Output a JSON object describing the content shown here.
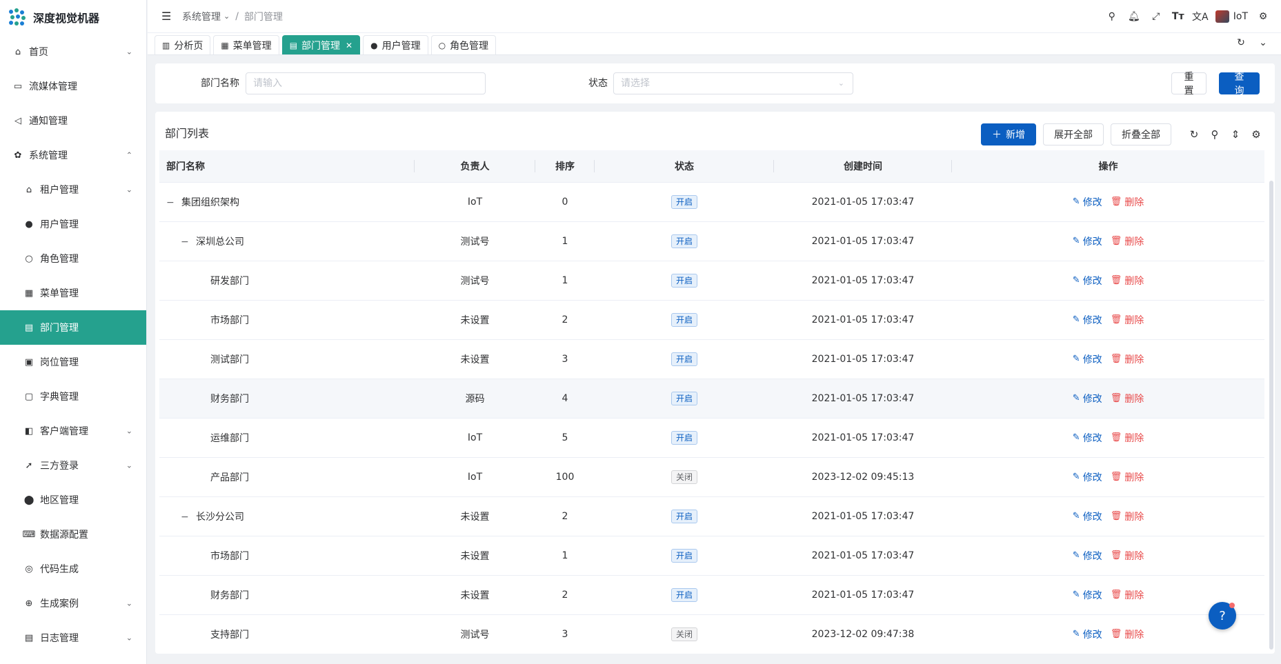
{
  "app": {
    "title": "深度视觉机器"
  },
  "sidebar": {
    "items": [
      {
        "label": "首页",
        "icon": "home-icon",
        "chevron": "⌄"
      },
      {
        "label": "流媒体管理",
        "icon": "video-icon",
        "chevron": ""
      },
      {
        "label": "通知管理",
        "icon": "megaphone-icon",
        "chevron": ""
      },
      {
        "label": "系统管理",
        "icon": "gear-icon",
        "chevron": "⌃"
      },
      {
        "label": "租户管理",
        "icon": "tenant-icon",
        "chevron": "⌄"
      },
      {
        "label": "用户管理",
        "icon": "user-icon",
        "chevron": ""
      },
      {
        "label": "角色管理",
        "icon": "role-icon",
        "chevron": ""
      },
      {
        "label": "菜单管理",
        "icon": "menu-grid-icon",
        "chevron": ""
      },
      {
        "label": "部门管理",
        "icon": "id-card-icon",
        "chevron": ""
      },
      {
        "label": "岗位管理",
        "icon": "post-icon",
        "chevron": ""
      },
      {
        "label": "字典管理",
        "icon": "dictionary-icon",
        "chevron": ""
      },
      {
        "label": "客户端管理",
        "icon": "client-icon",
        "chevron": "⌄"
      },
      {
        "label": "三方登录",
        "icon": "rocket-icon",
        "chevron": "⌄"
      },
      {
        "label": "地区管理",
        "icon": "location-icon",
        "chevron": ""
      },
      {
        "label": "数据源配置",
        "icon": "datasource-icon",
        "chevron": ""
      },
      {
        "label": "代码生成",
        "icon": "code-icon",
        "chevron": ""
      },
      {
        "label": "生成案例",
        "icon": "example-icon",
        "chevron": "⌄"
      },
      {
        "label": "日志管理",
        "icon": "log-icon",
        "chevron": "⌄"
      }
    ]
  },
  "header": {
    "breadcrumb": [
      "系统管理",
      "部门管理"
    ],
    "user": "IoT"
  },
  "tabs": [
    {
      "label": "分析页",
      "icon": "chart-icon"
    },
    {
      "label": "菜单管理",
      "icon": "menu-grid-icon"
    },
    {
      "label": "部门管理",
      "icon": "id-card-icon"
    },
    {
      "label": "用户管理",
      "icon": "user-icon"
    },
    {
      "label": "角色管理",
      "icon": "role-icon"
    }
  ],
  "search": {
    "dept_label": "部门名称",
    "dept_placeholder": "请输入",
    "status_label": "状态",
    "status_placeholder": "请选择",
    "reset": "重置",
    "query": "查询"
  },
  "table": {
    "title": "部门列表",
    "add": "新增",
    "expand_all": "展开全部",
    "collapse_all": "折叠全部",
    "columns": [
      "部门名称",
      "负责人",
      "排序",
      "状态",
      "创建时间",
      "操作"
    ],
    "edit_label": "修改",
    "delete_label": "删除",
    "rows": [
      {
        "name": "集团组织架构",
        "level": 0,
        "toggle": "−",
        "leader": "IoT",
        "sort": "0",
        "status": "开启",
        "on": true,
        "created": "2021-01-05 17:03:47"
      },
      {
        "name": "深圳总公司",
        "level": 1,
        "toggle": "−",
        "leader": "测试号",
        "sort": "1",
        "status": "开启",
        "on": true,
        "created": "2021-01-05 17:03:47"
      },
      {
        "name": "研发部门",
        "level": 2,
        "toggle": "",
        "leader": "测试号",
        "sort": "1",
        "status": "开启",
        "on": true,
        "created": "2021-01-05 17:03:47"
      },
      {
        "name": "市场部门",
        "level": 2,
        "toggle": "",
        "leader": "未设置",
        "sort": "2",
        "status": "开启",
        "on": true,
        "created": "2021-01-05 17:03:47"
      },
      {
        "name": "测试部门",
        "level": 2,
        "toggle": "",
        "leader": "未设置",
        "sort": "3",
        "status": "开启",
        "on": true,
        "created": "2021-01-05 17:03:47"
      },
      {
        "name": "财务部门",
        "level": 2,
        "toggle": "",
        "leader": "源码",
        "sort": "4",
        "status": "开启",
        "on": true,
        "created": "2021-01-05 17:03:47"
      },
      {
        "name": "运维部门",
        "level": 2,
        "toggle": "",
        "leader": "IoT",
        "sort": "5",
        "status": "开启",
        "on": true,
        "created": "2021-01-05 17:03:47"
      },
      {
        "name": "产品部门",
        "level": 2,
        "toggle": "",
        "leader": "IoT",
        "sort": "100",
        "status": "关闭",
        "on": false,
        "created": "2023-12-02 09:45:13"
      },
      {
        "name": "长沙分公司",
        "level": 1,
        "toggle": "−",
        "leader": "未设置",
        "sort": "2",
        "status": "开启",
        "on": true,
        "created": "2021-01-05 17:03:47"
      },
      {
        "name": "市场部门",
        "level": 2,
        "toggle": "",
        "leader": "未设置",
        "sort": "1",
        "status": "开启",
        "on": true,
        "created": "2021-01-05 17:03:47"
      },
      {
        "name": "财务部门",
        "level": 2,
        "toggle": "",
        "leader": "未设置",
        "sort": "2",
        "status": "开启",
        "on": true,
        "created": "2021-01-05 17:03:47"
      },
      {
        "name": "支持部门",
        "level": 2,
        "toggle": "",
        "leader": "测试号",
        "sort": "3",
        "status": "关闭",
        "on": false,
        "created": "2023-12-02 09:47:38"
      }
    ]
  },
  "colors": {
    "accent": "#25a18e",
    "primary": "#0b5ec1",
    "danger": "#e84a4a"
  }
}
